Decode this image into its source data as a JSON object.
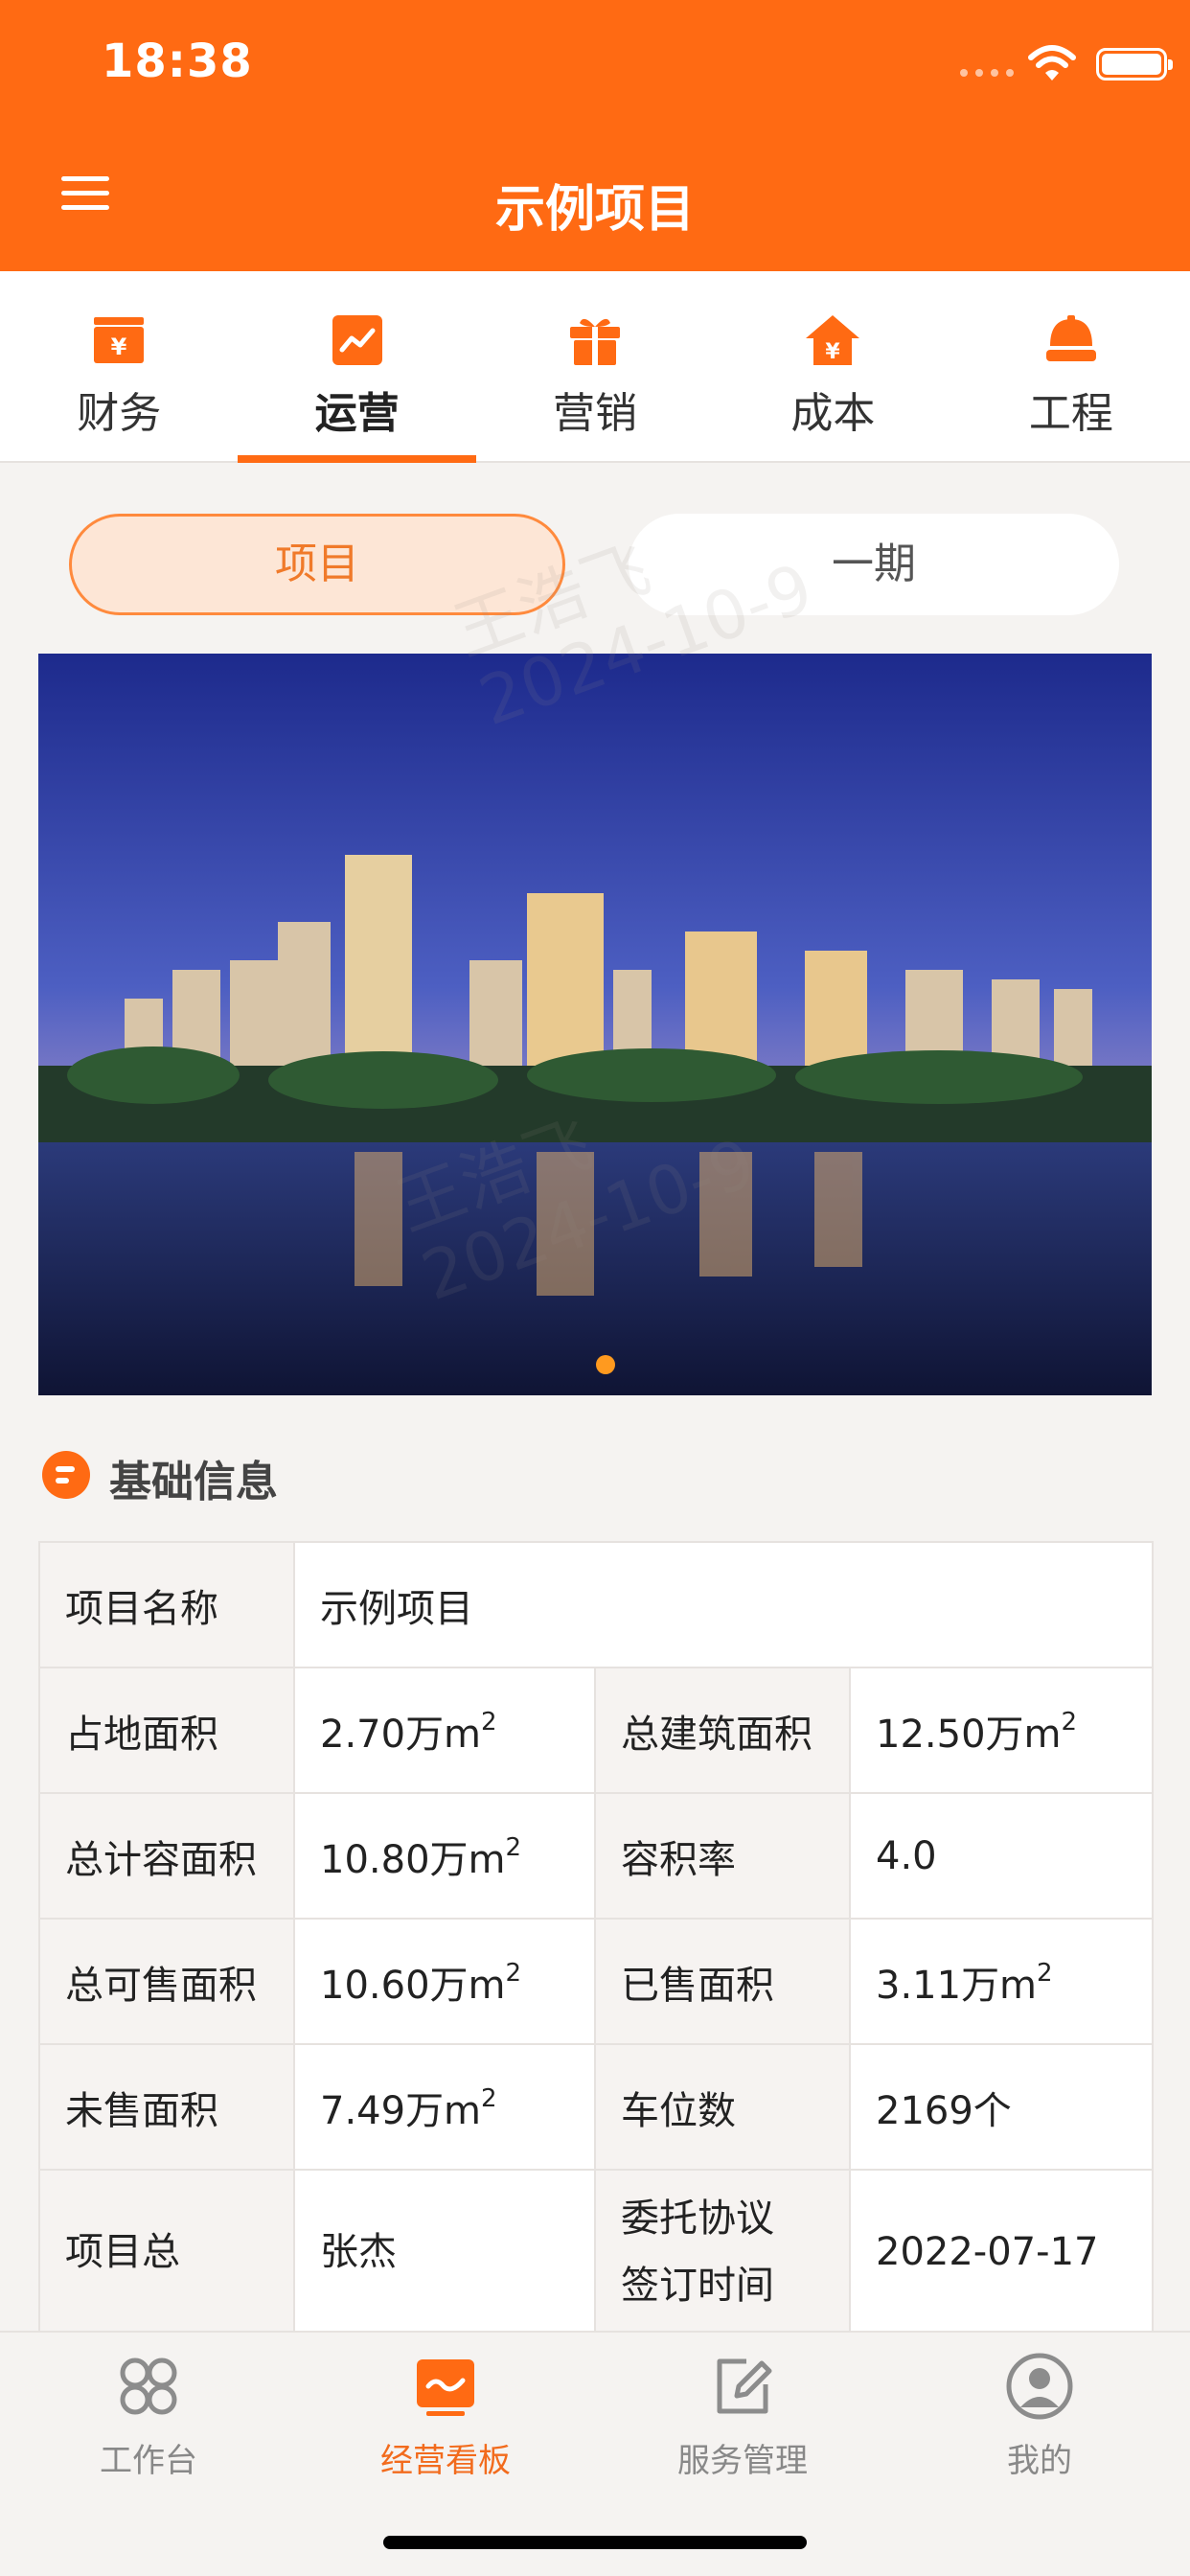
{
  "status_bar": {
    "time": "18:38"
  },
  "header": {
    "title": "示例项目"
  },
  "categories": [
    {
      "label": "财务",
      "icon": "finance-icon"
    },
    {
      "label": "运营",
      "icon": "operations-icon",
      "active": true
    },
    {
      "label": "营销",
      "icon": "marketing-gift-icon"
    },
    {
      "label": "成本",
      "icon": "cost-house-icon"
    },
    {
      "label": "工程",
      "icon": "engineering-helmet-icon"
    }
  ],
  "segments": {
    "left": "项目",
    "right": "一期"
  },
  "section": {
    "title": "基础信息"
  },
  "table": {
    "project_name_key": "项目名称",
    "project_name_val": "示例项目",
    "r1": {
      "k1": "占地面积",
      "v1": "2.70万m",
      "k2": "总建筑面积",
      "v2": "12.50万m"
    },
    "r2": {
      "k1": "总计容面积",
      "v1": "10.80万m",
      "k2": "容积率",
      "v2": "4.0"
    },
    "r3": {
      "k1": "总可售面积",
      "v1": "10.60万m",
      "k2": "已售面积",
      "v2": "3.11万m"
    },
    "r4": {
      "k1": "未售面积",
      "v1": "7.49万m",
      "k2": "车位数",
      "v2": "2169个"
    },
    "r5": {
      "k1": "项目总",
      "v1": "张杰",
      "k2a": "委托协议",
      "k2b": "签订时间",
      "v2": "2022-07-17"
    },
    "sq": "2"
  },
  "watermark": {
    "name": "王浩飞",
    "date": "2024-10-9"
  },
  "bottom_nav": [
    {
      "label": "工作台",
      "icon": "workbench-icon"
    },
    {
      "label": "经营看板",
      "icon": "dashboard-icon",
      "active": true
    },
    {
      "label": "服务管理",
      "icon": "edit-service-icon"
    },
    {
      "label": "我的",
      "icon": "profile-icon"
    }
  ],
  "colors": {
    "brand": "#ff6a13",
    "background": "#f5f3f1"
  }
}
